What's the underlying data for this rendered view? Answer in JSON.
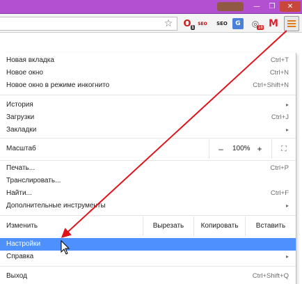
{
  "window": {
    "min_glyph": "—",
    "max_glyph": "❐",
    "close_glyph": "✕"
  },
  "toolbar": {
    "star_glyph": "☆",
    "opera_glyph": "O",
    "opera_count": "1",
    "seo1_label": "SEO",
    "seo2_label": "SEO",
    "translate_glyph": "G",
    "globe_glyph": "◎",
    "globe_count": "18",
    "gmail_glyph": "M"
  },
  "menu": {
    "new_tab": {
      "label": "Новая вкладка",
      "shortcut": "Ctrl+T"
    },
    "new_window": {
      "label": "Новое окно",
      "shortcut": "Ctrl+N"
    },
    "incognito": {
      "label": "Новое окно в режиме инкогнито",
      "shortcut": "Ctrl+Shift+N"
    },
    "history": {
      "label": "История",
      "arrow": "▸"
    },
    "downloads": {
      "label": "Загрузки",
      "shortcut": "Ctrl+J"
    },
    "bookmarks": {
      "label": "Закладки",
      "arrow": "▸"
    },
    "zoom": {
      "label": "Масштаб",
      "minus": "–",
      "value": "100%",
      "plus": "+",
      "fullscreen": "⛶"
    },
    "print": {
      "label": "Печать...",
      "shortcut": "Ctrl+P"
    },
    "cast": {
      "label": "Транслировать..."
    },
    "find": {
      "label": "Найти...",
      "shortcut": "Ctrl+F"
    },
    "more_tools": {
      "label": "Дополнительные инструменты",
      "arrow": "▸"
    },
    "edit": {
      "label": "Изменить",
      "cut": "Вырезать",
      "copy": "Копировать",
      "paste": "Вставить"
    },
    "settings": {
      "label": "Настройки"
    },
    "help": {
      "label": "Справка",
      "arrow": "▸"
    },
    "exit": {
      "label": "Выход",
      "shortcut": "Ctrl+Shift+Q"
    }
  },
  "colors": {
    "titlebar": "#b34fd1",
    "highlight": "#4d90fe",
    "annotation": "#e0121a"
  }
}
